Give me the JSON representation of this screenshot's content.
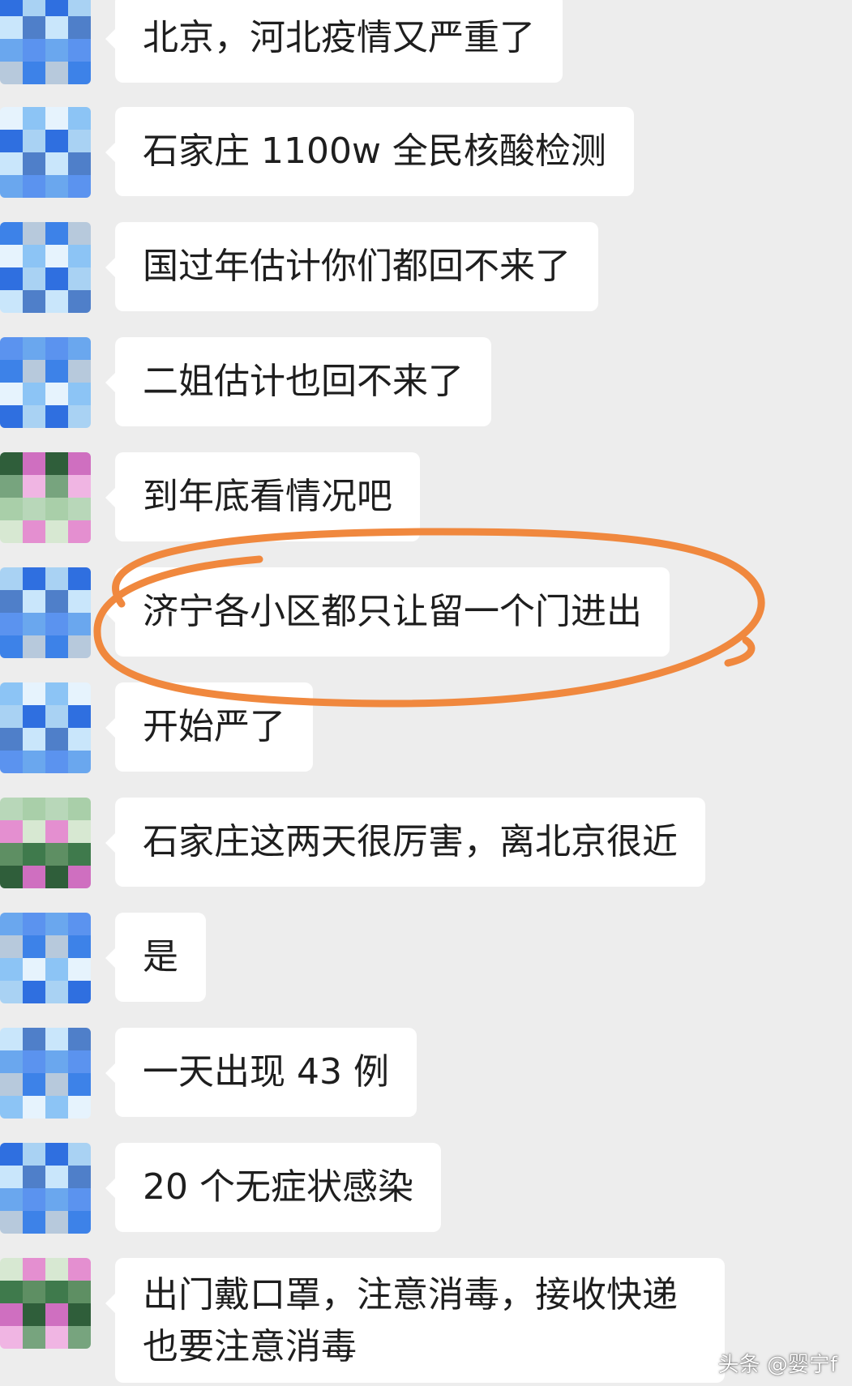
{
  "messages": [
    {
      "text": "北京，河北疫情又严重了",
      "avatar": "blue"
    },
    {
      "text": "石家庄 1100w 全民核酸检测",
      "avatar": "blue"
    },
    {
      "text": "国过年估计你们都回不来了",
      "avatar": "blue"
    },
    {
      "text": "二姐估计也回不来了",
      "avatar": "blue"
    },
    {
      "text": "到年底看情况吧",
      "avatar": "green-pink"
    },
    {
      "text": "济宁各小区都只让留一个门进出",
      "avatar": "blue",
      "highlighted": true
    },
    {
      "text": "开始严了",
      "avatar": "blue"
    },
    {
      "text": "石家庄这两天很厉害，离北京很近",
      "avatar": "green-pink"
    },
    {
      "text": "是",
      "avatar": "blue"
    },
    {
      "text": "一天出现 43 例",
      "avatar": "blue"
    },
    {
      "text": "20 个无症状感染",
      "avatar": "blue"
    },
    {
      "text": "出门戴口罩，注意消毒，接收快递也要注意消毒",
      "avatar": "green-pink"
    }
  ],
  "watermark": "头条 @婴宁f",
  "colors": {
    "background": "#ededed",
    "bubble": "#ffffff",
    "text": "#1e1e1e",
    "highlight_circle": "#f0883e"
  }
}
